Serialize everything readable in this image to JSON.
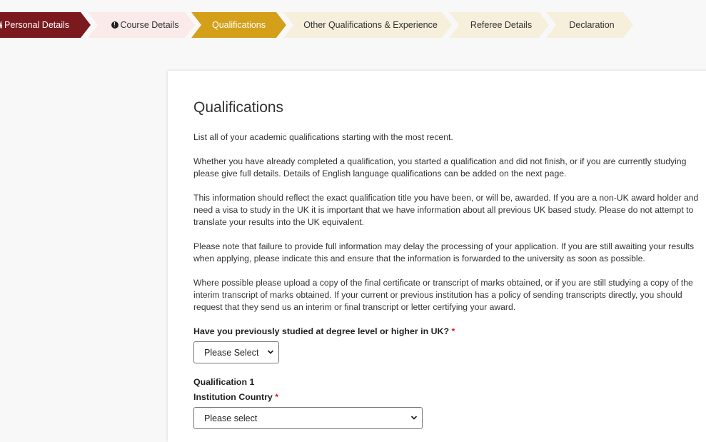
{
  "stepper": {
    "steps": [
      {
        "label": "Personal Details",
        "state": "error-complete",
        "icon": "exclamation-circle-icon"
      },
      {
        "label": "Course Details",
        "state": "error",
        "icon": "exclamation-circle-icon"
      },
      {
        "label": "Qualifications",
        "state": "active"
      },
      {
        "label": "Other Qualifications & Experience",
        "state": "pending"
      },
      {
        "label": "Referee Details",
        "state": "pending"
      },
      {
        "label": "Declaration",
        "state": "pending"
      }
    ],
    "icon_glyph": "!"
  },
  "main": {
    "title": "Qualifications",
    "paragraphs": [
      "List all of your academic qualifications starting with the most recent.",
      "Whether you have already completed a qualification, you started a qualification and did not finish, or if you are currently studying please give full details. Details of English language qualifications can be added on the next page.",
      "This information should reflect the exact qualification title you have been, or will be, awarded. If you are a non-UK award holder and need a visa to study in the UK it is important that we have information about all previous UK based study. Please do not attempt to translate your results into the UK equivalent.",
      "Please note that failure to provide full information may delay the processing of your application. If you are still awaiting your results when applying, please indicate this and ensure that the information is forwarded to the university as soon as possible.",
      "Where possible please upload a copy of the final certificate or transcript of marks obtained, or if you are still studying a copy of the interim transcript of marks obtained. If your current or previous institution has a policy of sending transcripts directly, you should request that they send us an interim or final transcript or letter certifying your award."
    ],
    "uk_question": {
      "label": "Have you previously studied at degree level or higher in UK?",
      "required_mark": "*",
      "selected": "Please Select"
    },
    "qualification_heading": "Qualification 1",
    "institution_country": {
      "label": "Institution Country",
      "required_mark": "*",
      "selected": "Please select"
    }
  },
  "colors": {
    "personal_step": "#7a1a1e",
    "active_step": "#d4a01a",
    "error_step": "#fbeaea",
    "pending_step": "#f6efdc",
    "required": "#d0202a"
  }
}
